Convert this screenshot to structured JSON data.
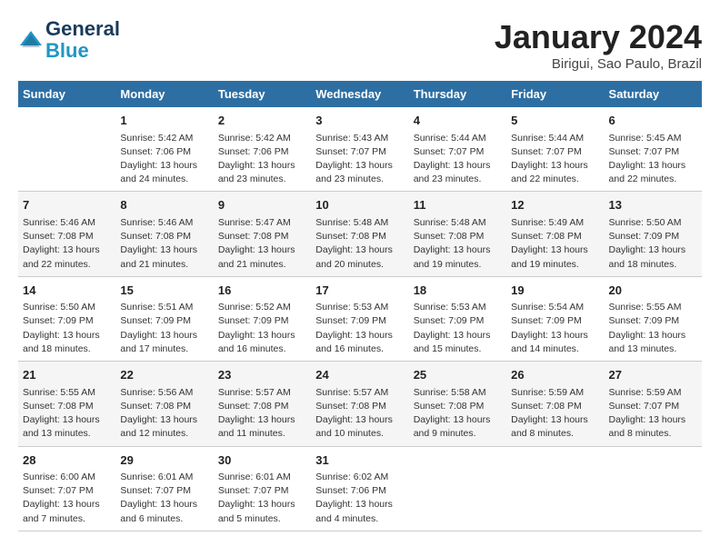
{
  "logo": {
    "line1": "General",
    "line2": "Blue"
  },
  "title": "January 2024",
  "subtitle": "Birigui, Sao Paulo, Brazil",
  "headers": [
    "Sunday",
    "Monday",
    "Tuesday",
    "Wednesday",
    "Thursday",
    "Friday",
    "Saturday"
  ],
  "weeks": [
    [
      {
        "day": "",
        "content": ""
      },
      {
        "day": "1",
        "content": "Sunrise: 5:42 AM\nSunset: 7:06 PM\nDaylight: 13 hours\nand 24 minutes."
      },
      {
        "day": "2",
        "content": "Sunrise: 5:42 AM\nSunset: 7:06 PM\nDaylight: 13 hours\nand 23 minutes."
      },
      {
        "day": "3",
        "content": "Sunrise: 5:43 AM\nSunset: 7:07 PM\nDaylight: 13 hours\nand 23 minutes."
      },
      {
        "day": "4",
        "content": "Sunrise: 5:44 AM\nSunset: 7:07 PM\nDaylight: 13 hours\nand 23 minutes."
      },
      {
        "day": "5",
        "content": "Sunrise: 5:44 AM\nSunset: 7:07 PM\nDaylight: 13 hours\nand 22 minutes."
      },
      {
        "day": "6",
        "content": "Sunrise: 5:45 AM\nSunset: 7:07 PM\nDaylight: 13 hours\nand 22 minutes."
      }
    ],
    [
      {
        "day": "7",
        "content": "Sunrise: 5:46 AM\nSunset: 7:08 PM\nDaylight: 13 hours\nand 22 minutes."
      },
      {
        "day": "8",
        "content": "Sunrise: 5:46 AM\nSunset: 7:08 PM\nDaylight: 13 hours\nand 21 minutes."
      },
      {
        "day": "9",
        "content": "Sunrise: 5:47 AM\nSunset: 7:08 PM\nDaylight: 13 hours\nand 21 minutes."
      },
      {
        "day": "10",
        "content": "Sunrise: 5:48 AM\nSunset: 7:08 PM\nDaylight: 13 hours\nand 20 minutes."
      },
      {
        "day": "11",
        "content": "Sunrise: 5:48 AM\nSunset: 7:08 PM\nDaylight: 13 hours\nand 19 minutes."
      },
      {
        "day": "12",
        "content": "Sunrise: 5:49 AM\nSunset: 7:08 PM\nDaylight: 13 hours\nand 19 minutes."
      },
      {
        "day": "13",
        "content": "Sunrise: 5:50 AM\nSunset: 7:09 PM\nDaylight: 13 hours\nand 18 minutes."
      }
    ],
    [
      {
        "day": "14",
        "content": "Sunrise: 5:50 AM\nSunset: 7:09 PM\nDaylight: 13 hours\nand 18 minutes."
      },
      {
        "day": "15",
        "content": "Sunrise: 5:51 AM\nSunset: 7:09 PM\nDaylight: 13 hours\nand 17 minutes."
      },
      {
        "day": "16",
        "content": "Sunrise: 5:52 AM\nSunset: 7:09 PM\nDaylight: 13 hours\nand 16 minutes."
      },
      {
        "day": "17",
        "content": "Sunrise: 5:53 AM\nSunset: 7:09 PM\nDaylight: 13 hours\nand 16 minutes."
      },
      {
        "day": "18",
        "content": "Sunrise: 5:53 AM\nSunset: 7:09 PM\nDaylight: 13 hours\nand 15 minutes."
      },
      {
        "day": "19",
        "content": "Sunrise: 5:54 AM\nSunset: 7:09 PM\nDaylight: 13 hours\nand 14 minutes."
      },
      {
        "day": "20",
        "content": "Sunrise: 5:55 AM\nSunset: 7:09 PM\nDaylight: 13 hours\nand 13 minutes."
      }
    ],
    [
      {
        "day": "21",
        "content": "Sunrise: 5:55 AM\nSunset: 7:08 PM\nDaylight: 13 hours\nand 13 minutes."
      },
      {
        "day": "22",
        "content": "Sunrise: 5:56 AM\nSunset: 7:08 PM\nDaylight: 13 hours\nand 12 minutes."
      },
      {
        "day": "23",
        "content": "Sunrise: 5:57 AM\nSunset: 7:08 PM\nDaylight: 13 hours\nand 11 minutes."
      },
      {
        "day": "24",
        "content": "Sunrise: 5:57 AM\nSunset: 7:08 PM\nDaylight: 13 hours\nand 10 minutes."
      },
      {
        "day": "25",
        "content": "Sunrise: 5:58 AM\nSunset: 7:08 PM\nDaylight: 13 hours\nand 9 minutes."
      },
      {
        "day": "26",
        "content": "Sunrise: 5:59 AM\nSunset: 7:08 PM\nDaylight: 13 hours\nand 8 minutes."
      },
      {
        "day": "27",
        "content": "Sunrise: 5:59 AM\nSunset: 7:07 PM\nDaylight: 13 hours\nand 8 minutes."
      }
    ],
    [
      {
        "day": "28",
        "content": "Sunrise: 6:00 AM\nSunset: 7:07 PM\nDaylight: 13 hours\nand 7 minutes."
      },
      {
        "day": "29",
        "content": "Sunrise: 6:01 AM\nSunset: 7:07 PM\nDaylight: 13 hours\nand 6 minutes."
      },
      {
        "day": "30",
        "content": "Sunrise: 6:01 AM\nSunset: 7:07 PM\nDaylight: 13 hours\nand 5 minutes."
      },
      {
        "day": "31",
        "content": "Sunrise: 6:02 AM\nSunset: 7:06 PM\nDaylight: 13 hours\nand 4 minutes."
      },
      {
        "day": "",
        "content": ""
      },
      {
        "day": "",
        "content": ""
      },
      {
        "day": "",
        "content": ""
      }
    ]
  ]
}
